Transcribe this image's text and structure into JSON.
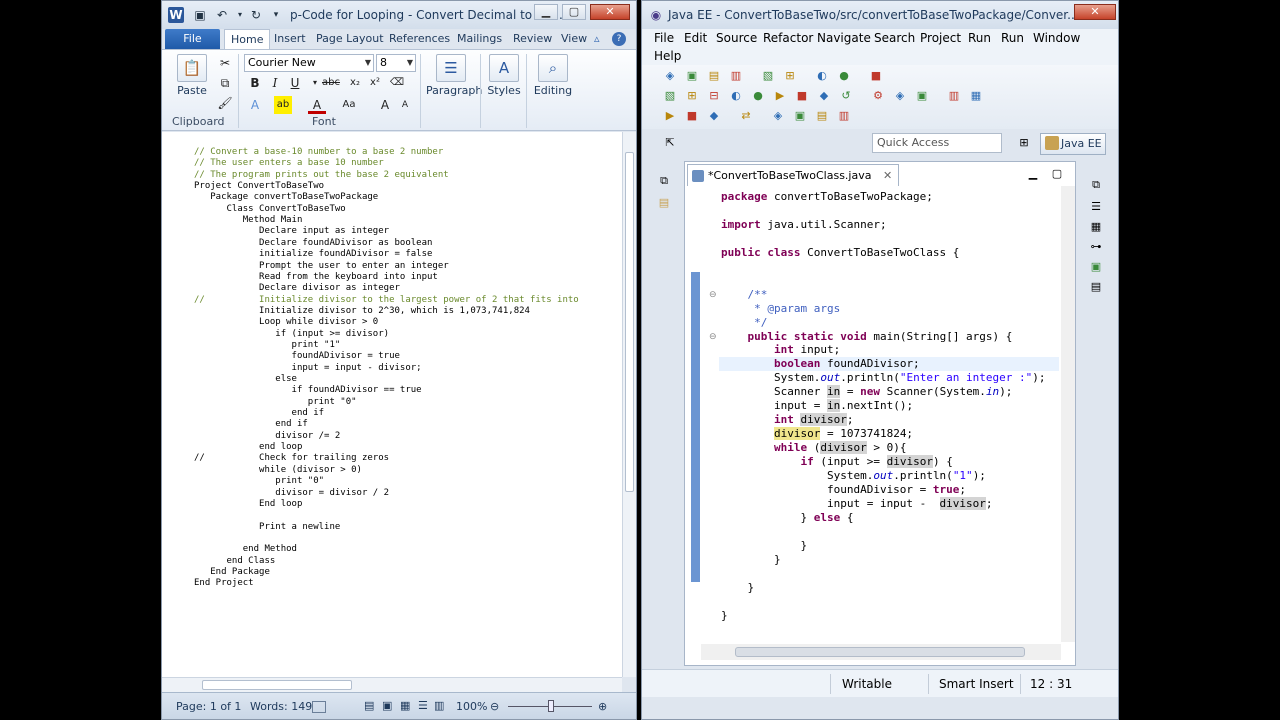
{
  "word": {
    "title": "p-Code for Looping - Convert Decimal to Bin...",
    "file_tab": "File",
    "tabs": [
      "Home",
      "Insert",
      "Page Layout",
      "References",
      "Mailings",
      "Review",
      "View"
    ],
    "font_name": "Courier New",
    "font_size": "8",
    "groups": {
      "clipboard": "Clipboard",
      "font": "Font",
      "paragraph": "Paragraph",
      "styles": "Styles",
      "editing": "Editing"
    },
    "paste_label": "Paste",
    "document_lines": [
      {
        "text": "// Convert a base-10 number to a base 2 number",
        "comment": true
      },
      {
        "text": "// The user enters a base 10 number",
        "comment": true
      },
      {
        "text": "// The program prints out the base 2 equivalent",
        "comment": true
      },
      {
        "text": "Project ConvertToBaseTwo",
        "comment": false
      },
      {
        "text": "   Package convertToBaseTwoPackage",
        "comment": false
      },
      {
        "text": "      Class ConvertToBaseTwo",
        "comment": false
      },
      {
        "text": "         Method Main",
        "comment": false
      },
      {
        "text": "            Declare input as integer",
        "comment": false
      },
      {
        "text": "            Declare foundADivisor as boolean",
        "comment": false
      },
      {
        "text": "            initialize foundADivisor = false",
        "comment": false
      },
      {
        "text": "            Prompt the user to enter an integer",
        "comment": false
      },
      {
        "text": "            Read from the keyboard into input",
        "comment": false
      },
      {
        "text": "            Declare divisor as integer",
        "comment": false
      },
      {
        "text": "//          Initialize divisor to the largest power of 2 that fits into",
        "comment": true
      },
      {
        "text": "            Initialize divisor to 2^30, which is 1,073,741,824",
        "comment": false
      },
      {
        "text": "            Loop while divisor > 0",
        "comment": false
      },
      {
        "text": "               if (input >= divisor)",
        "comment": false
      },
      {
        "text": "                  print \"1\"",
        "comment": false
      },
      {
        "text": "                  foundADivisor = true",
        "comment": false
      },
      {
        "text": "                  input = input - divisor;",
        "comment": false
      },
      {
        "text": "               else",
        "comment": false
      },
      {
        "text": "                  if foundADivisor == true",
        "comment": false
      },
      {
        "text": "                     print \"0\"",
        "comment": false
      },
      {
        "text": "                  end if",
        "comment": false
      },
      {
        "text": "               end if",
        "comment": false
      },
      {
        "text": "               divisor /= 2",
        "comment": false
      },
      {
        "text": "            end loop",
        "comment": false
      },
      {
        "text": "//          Check for trailing zeros",
        "comment": false
      },
      {
        "text": "            while (divisor > 0)",
        "comment": false
      },
      {
        "text": "               print \"0\"",
        "comment": false
      },
      {
        "text": "               divisor = divisor / 2",
        "comment": false
      },
      {
        "text": "            End loop",
        "comment": false
      },
      {
        "text": "",
        "comment": false
      },
      {
        "text": "            Print a newline",
        "comment": false
      },
      {
        "text": "",
        "comment": false
      },
      {
        "text": "         end Method",
        "comment": false
      },
      {
        "text": "      end Class",
        "comment": false
      },
      {
        "text": "   End Package",
        "comment": false
      },
      {
        "text": "End Project",
        "comment": false
      }
    ],
    "status": {
      "page": "Page: 1 of 1",
      "words": "Words: 149",
      "zoom": "100%"
    }
  },
  "eclipse": {
    "title": "Java EE - ConvertToBaseTwo/src/convertToBaseTwoPackage/Conver...",
    "menu": [
      "File",
      "Edit",
      "Source",
      "Refactor",
      "Navigate",
      "Search",
      "Project",
      "Run",
      "Run",
      "Window",
      "Help"
    ],
    "quick_access": "Quick Access",
    "perspective": "Java EE",
    "editor_tab": "*ConvertToBaseTwoClass.java",
    "status": {
      "mode": "Writable",
      "insert": "Smart Insert",
      "position": "12 : 31"
    }
  }
}
